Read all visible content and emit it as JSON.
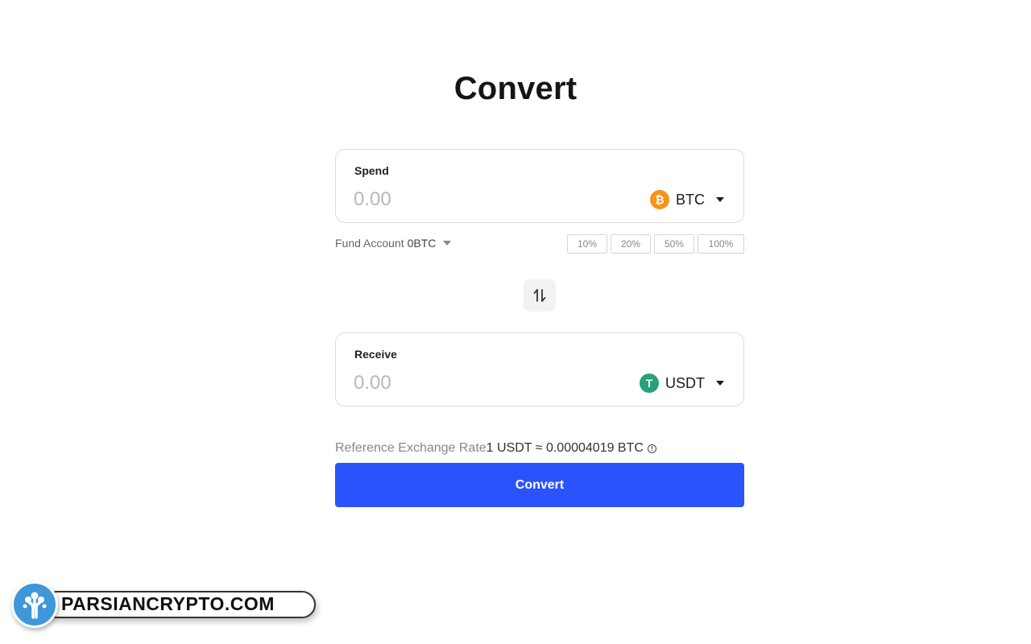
{
  "page": {
    "title": "Convert"
  },
  "spend": {
    "label": "Spend",
    "placeholder": "0.00",
    "coin": "BTC",
    "coin_icon": "bitcoin-icon",
    "coin_color": "#f7931a",
    "coin_glyph": "₿"
  },
  "fund": {
    "label": "Fund Account",
    "balance": "0BTC"
  },
  "percent_buttons": [
    "10%",
    "20%",
    "50%",
    "100%"
  ],
  "receive": {
    "label": "Receive",
    "placeholder": "0.00",
    "coin": "USDT",
    "coin_icon": "tether-icon",
    "coin_color": "#26a17b",
    "coin_glyph": "T"
  },
  "rate": {
    "label": "Reference Exchange Rate",
    "value": "1 USDT ≈ 0.00004019 BTC"
  },
  "convert_button": {
    "label": "Convert",
    "color": "#2b53fc"
  },
  "watermark": {
    "text": "PARSIANCRYPTO.COM"
  }
}
